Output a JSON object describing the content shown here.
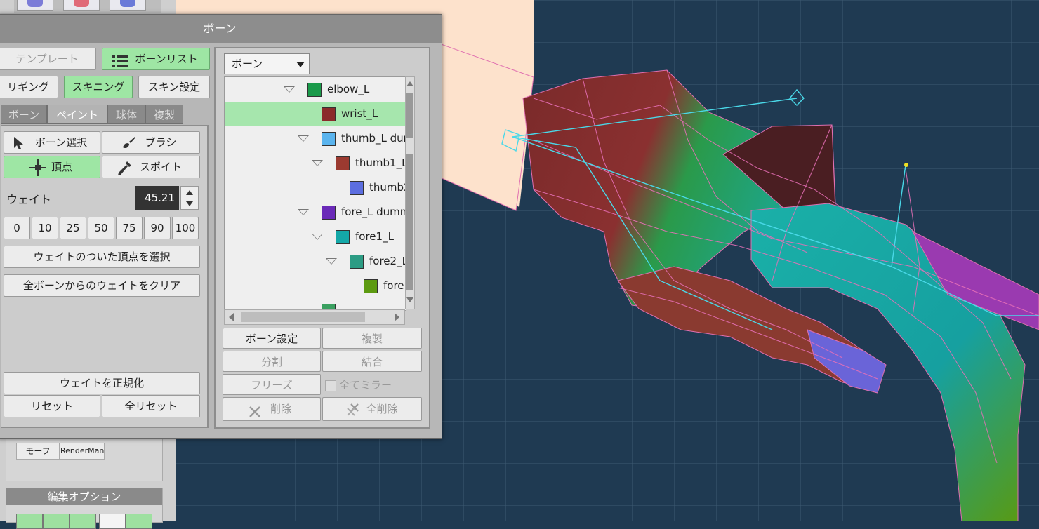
{
  "dialog": {
    "title": "ボーン",
    "template_label": "テンプレート",
    "bone_list_label": "ボーンリスト",
    "rigging_label": "リギング",
    "skinning_label": "スキニング",
    "skin_settings_label": "スキン設定",
    "tabs": [
      "ボーン",
      "ペイント",
      "球体",
      "複製"
    ],
    "active_tab": "ペイント"
  },
  "paint": {
    "bone_select_label": "ボーン選択",
    "brush_label": "ブラシ",
    "vertex_label": "頂点",
    "dropper_label": "スポイト",
    "weight_label": "ウェイト",
    "weight_value": "45.21",
    "quick_values": [
      "0",
      "10",
      "25",
      "50",
      "75",
      "90",
      "100"
    ],
    "select_weighted_label": "ウェイトのついた頂点を選択",
    "clear_all_label": "全ボーンからのウェイトをクリア",
    "normalize_label": "ウェイトを正規化",
    "reset_label": "リセット",
    "reset_all_label": "全リセット"
  },
  "bone_panel": {
    "select_value": "ボーン",
    "tree": [
      {
        "label": "elbow_L",
        "color": "#1a9a4a",
        "expanded": true
      },
      {
        "label": "wrist_L",
        "color": "#8b2b2b",
        "selected": true
      },
      {
        "label": "thumb_L dun",
        "color": "#5ab4ee",
        "expanded": true
      },
      {
        "label": "thumb1_L",
        "color": "#9b3a30",
        "expanded": true
      },
      {
        "label": "thumb2",
        "color": "#5c6ee0"
      },
      {
        "label": "fore_L dumn",
        "color": "#6a2ab8",
        "expanded": true
      },
      {
        "label": "fore1_L",
        "color": "#14a8a8",
        "expanded": true
      },
      {
        "label": "fore2_L",
        "color": "#2c9c84",
        "expanded": true
      },
      {
        "label": "fore",
        "color": "#5c9a10"
      }
    ],
    "bone_settings_label": "ボーン設定",
    "duplicate_label": "複製",
    "split_label": "分割",
    "merge_label": "結合",
    "freeze_label": "フリーズ",
    "mirror_all_label": "全てミラー",
    "delete_label": "削除",
    "delete_all_label": "全削除"
  },
  "side": {
    "morph_label": "モーフ",
    "renderman_label": "RenderMan",
    "edit_options_label": "編集オプション"
  }
}
